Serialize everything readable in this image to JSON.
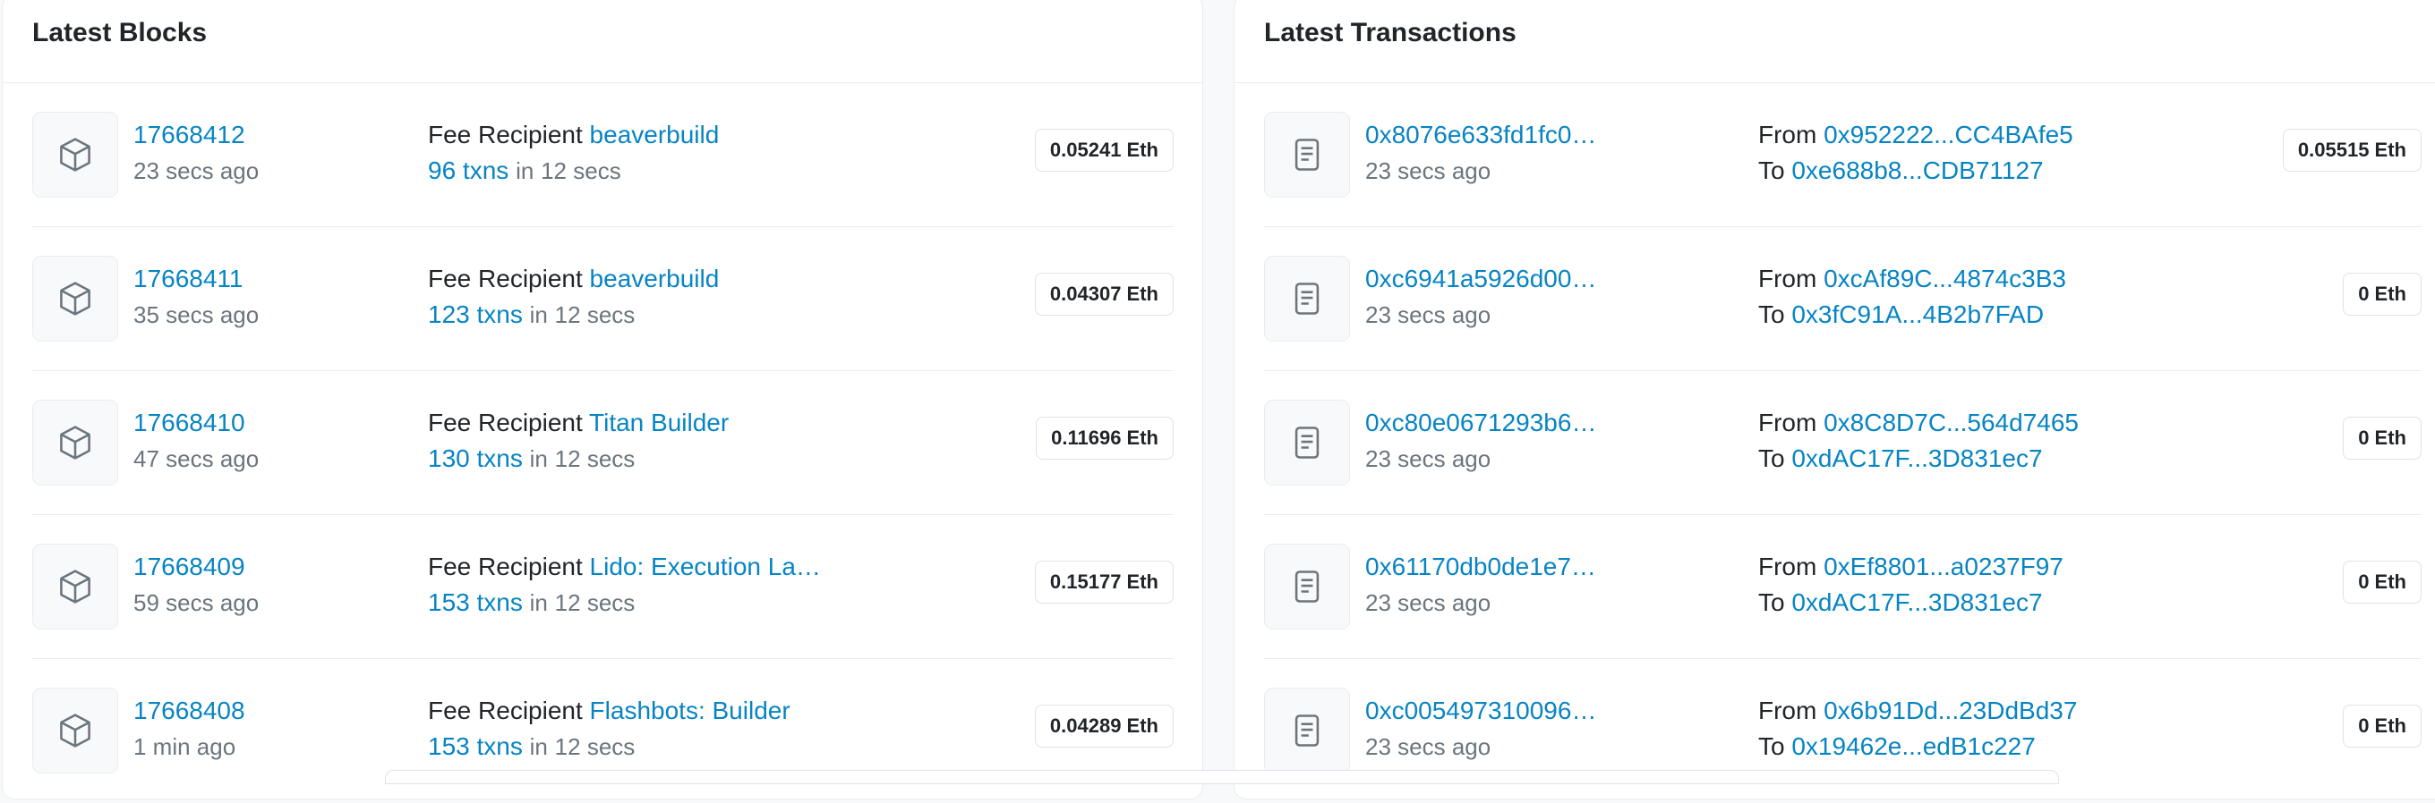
{
  "blocks": {
    "title": "Latest Blocks",
    "fee_recipient_label": "Fee Recipient",
    "in_label": "in",
    "items": [
      {
        "number": "17668412",
        "age": "23 secs ago",
        "recipient": "beaverbuild",
        "txns": "96 txns",
        "duration": "12 secs",
        "reward": "0.05241 Eth"
      },
      {
        "number": "17668411",
        "age": "35 secs ago",
        "recipient": "beaverbuild",
        "txns": "123 txns",
        "duration": "12 secs",
        "reward": "0.04307 Eth"
      },
      {
        "number": "17668410",
        "age": "47 secs ago",
        "recipient": "Titan Builder",
        "txns": "130 txns",
        "duration": "12 secs",
        "reward": "0.11696 Eth"
      },
      {
        "number": "17668409",
        "age": "59 secs ago",
        "recipient": "Lido: Execution La…",
        "txns": "153 txns",
        "duration": "12 secs",
        "reward": "0.15177 Eth"
      },
      {
        "number": "17668408",
        "age": "1 min ago",
        "recipient": "Flashbots: Builder",
        "txns": "153 txns",
        "duration": "12 secs",
        "reward": "0.04289 Eth"
      }
    ]
  },
  "transactions": {
    "title": "Latest Transactions",
    "from_label": "From",
    "to_label": "To",
    "items": [
      {
        "hash": "0x8076e633fd1fc0…",
        "age": "23 secs ago",
        "from": "0x952222...CC4BAfe5",
        "to": "0xe688b8...CDB71127",
        "value": "0.05515 Eth"
      },
      {
        "hash": "0xc6941a5926d00…",
        "age": "23 secs ago",
        "from": "0xcAf89C...4874c3B3",
        "to": "0x3fC91A...4B2b7FAD",
        "value": "0 Eth"
      },
      {
        "hash": "0xc80e0671293b6…",
        "age": "23 secs ago",
        "from": "0x8C8D7C...564d7465",
        "to": "0xdAC17F...3D831ec7",
        "value": "0 Eth"
      },
      {
        "hash": "0x61170db0de1e7…",
        "age": "23 secs ago",
        "from": "0xEf8801...a0237F97",
        "to": "0xdAC17F...3D831ec7",
        "value": "0 Eth"
      },
      {
        "hash": "0xc005497310096…",
        "age": "23 secs ago",
        "from": "0x6b91Dd...23DdBd37",
        "to": "0x19462e...edB1c227",
        "value": "0 Eth"
      }
    ]
  },
  "icons": {
    "block": "cube-icon",
    "transaction": "document-icon"
  },
  "colors": {
    "link": "#0784c3",
    "muted": "#6c757d",
    "border": "#e9ecef"
  }
}
